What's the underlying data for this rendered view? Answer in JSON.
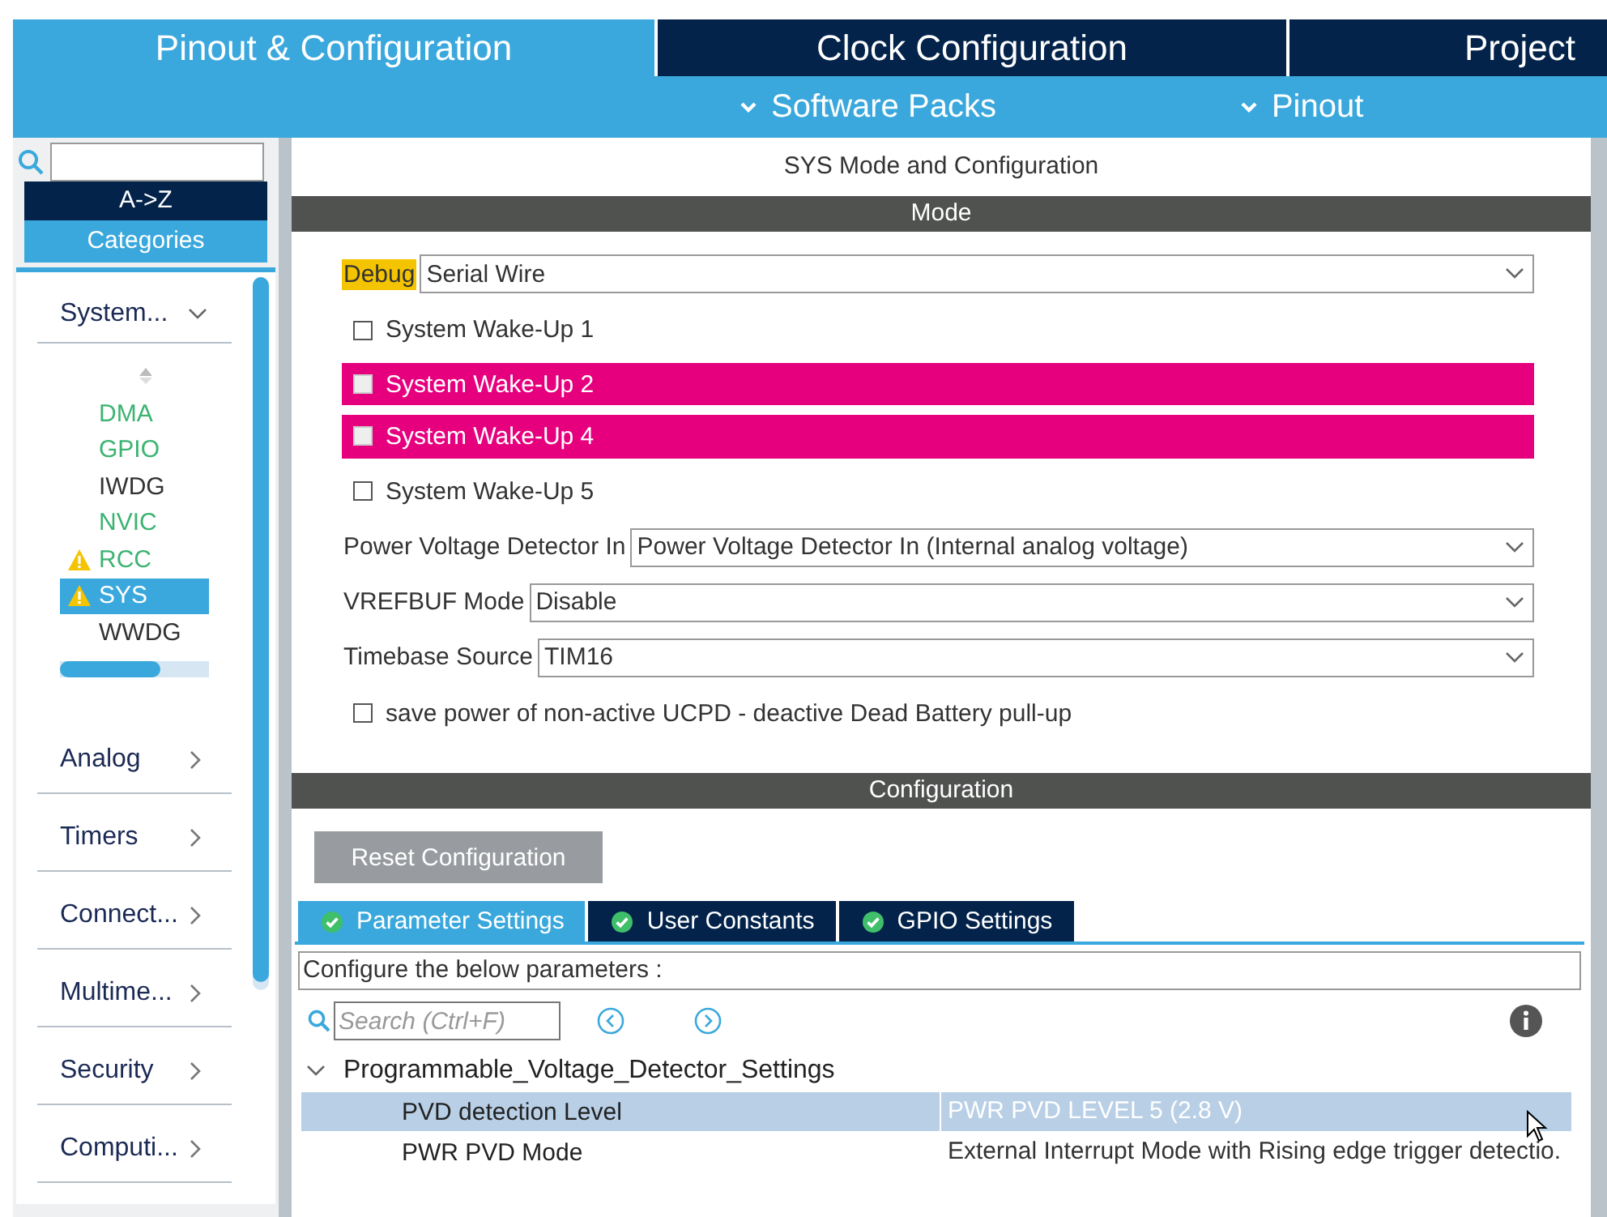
{
  "top_tabs": [
    {
      "label": "Pinout & Configuration",
      "selected": true
    },
    {
      "label": "Clock Configuration",
      "selected": false
    },
    {
      "label": "Project",
      "selected": false
    }
  ],
  "sub_menus": [
    {
      "label": "Software Packs"
    },
    {
      "label": "Pinout"
    }
  ],
  "sidebar": {
    "sort_buttons": [
      {
        "label": "A->Z",
        "selected": false
      },
      {
        "label": "Categories",
        "selected": true
      }
    ],
    "categories": [
      {
        "label": "System...",
        "expanded": true,
        "children": [
          {
            "label": "DMA",
            "configured": true,
            "warning": false,
            "selected": false
          },
          {
            "label": "GPIO",
            "configured": true,
            "warning": false,
            "selected": false
          },
          {
            "label": "IWDG",
            "configured": false,
            "warning": false,
            "selected": false
          },
          {
            "label": "NVIC",
            "configured": true,
            "warning": false,
            "selected": false
          },
          {
            "label": "RCC",
            "configured": true,
            "warning": true,
            "selected": false
          },
          {
            "label": "SYS",
            "configured": true,
            "warning": true,
            "selected": true
          },
          {
            "label": "WWDG",
            "configured": false,
            "warning": false,
            "selected": false
          }
        ]
      },
      {
        "label": "Analog",
        "expanded": false
      },
      {
        "label": "Timers",
        "expanded": false
      },
      {
        "label": "Connect...",
        "expanded": false
      },
      {
        "label": "Multime...",
        "expanded": false
      },
      {
        "label": "Security",
        "expanded": false
      },
      {
        "label": "Computi...",
        "expanded": false
      }
    ]
  },
  "panel_title": "SYS Mode and Configuration",
  "mode": {
    "header": "Mode",
    "rows": [
      {
        "kind": "select",
        "label": "Debug",
        "highlighted": true,
        "value": "Serial Wire"
      },
      {
        "kind": "checkbox",
        "label": "System Wake-Up 1",
        "checked": false,
        "conflict": false
      },
      {
        "kind": "checkbox",
        "label": "System Wake-Up 2",
        "checked": false,
        "conflict": true
      },
      {
        "kind": "checkbox",
        "label": "System Wake-Up 4",
        "checked": false,
        "conflict": true
      },
      {
        "kind": "checkbox",
        "label": "System Wake-Up 5",
        "checked": false,
        "conflict": false
      },
      {
        "kind": "select",
        "label": "Power Voltage Detector In",
        "highlighted": false,
        "value": "Power Voltage Detector In (Internal analog voltage)"
      },
      {
        "kind": "select",
        "label": "VREFBUF Mode",
        "highlighted": false,
        "value": "Disable"
      },
      {
        "kind": "select",
        "label": "Timebase Source",
        "highlighted": false,
        "value": "TIM16"
      },
      {
        "kind": "checkbox",
        "label": "save power of non-active UCPD - deactive Dead Battery pull-up",
        "checked": false,
        "conflict": false
      }
    ]
  },
  "configuration": {
    "header": "Configuration",
    "reset_button": "Reset Configuration",
    "tabs": [
      {
        "label": "Parameter Settings",
        "selected": true
      },
      {
        "label": "User Constants",
        "selected": false
      },
      {
        "label": "GPIO Settings",
        "selected": false
      }
    ],
    "hint": "Configure the below parameters :",
    "search": {
      "placeholder": "Search (Ctrl+F)"
    },
    "groups": [
      {
        "label": "Programmable_Voltage_Detector_Settings",
        "expanded": true,
        "rows": [
          {
            "name": "PVD detection Level",
            "value": "PWR PVD LEVEL 5 (2.8 V)",
            "selected": true
          },
          {
            "name": "PWR PVD Mode",
            "value": "External Interrupt Mode with Rising edge trigger detectio.",
            "selected": false
          }
        ]
      }
    ]
  }
}
